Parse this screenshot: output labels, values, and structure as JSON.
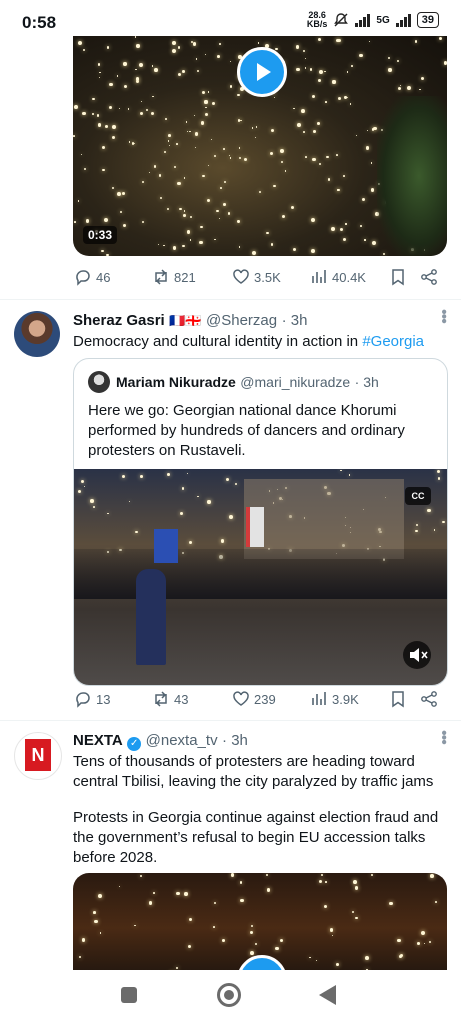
{
  "status_bar": {
    "time": "0:58",
    "net_speed_top": "28.6",
    "net_speed_unit": "KB/s",
    "net_type": "5G",
    "battery": "39"
  },
  "post1": {
    "video_duration": "0:33",
    "replies": "46",
    "reposts": "821",
    "likes": "3.5K",
    "views": "40.4K"
  },
  "post2": {
    "author_name": "Sheraz Gasri",
    "flags": "🇫🇷🇬🇪",
    "handle": "@Sherzag",
    "time": "· 3h",
    "text": "Democracy and cultural identity in action in",
    "hashtag": "#Georgia",
    "quote": {
      "author_name": "Mariam Nikuradze",
      "handle": "@mari_nikuradze",
      "time": "· 3h",
      "text": "Here we go: Georgian national dance Khorumi performed by hundreds of dancers and ordinary protesters on Rustaveli.",
      "cc_label": "CC"
    },
    "replies": "13",
    "reposts": "43",
    "likes": "239",
    "views": "3.9K"
  },
  "post3": {
    "author_name": "NEXTA",
    "handle": "@nexta_tv",
    "time": "· 3h",
    "avatar_letter": "N",
    "text_p1": "Tens of thousands of protesters are heading toward central Tbilisi, leaving the city paralyzed by traffic jams",
    "text_p2": "Protests in Georgia continue against election fraud and the government’s refusal to begin EU accession talks before 2028."
  },
  "colors": {
    "accent": "#1d9bf0",
    "muted": "#536471",
    "verified": "#1d9bf0",
    "nexta_red": "#d71a21"
  },
  "icons": [
    "reply-icon",
    "repost-icon",
    "like-icon",
    "views-icon",
    "bookmark-icon",
    "share-icon",
    "play-icon",
    "cc-icon",
    "mute-icon",
    "more-icon"
  ]
}
